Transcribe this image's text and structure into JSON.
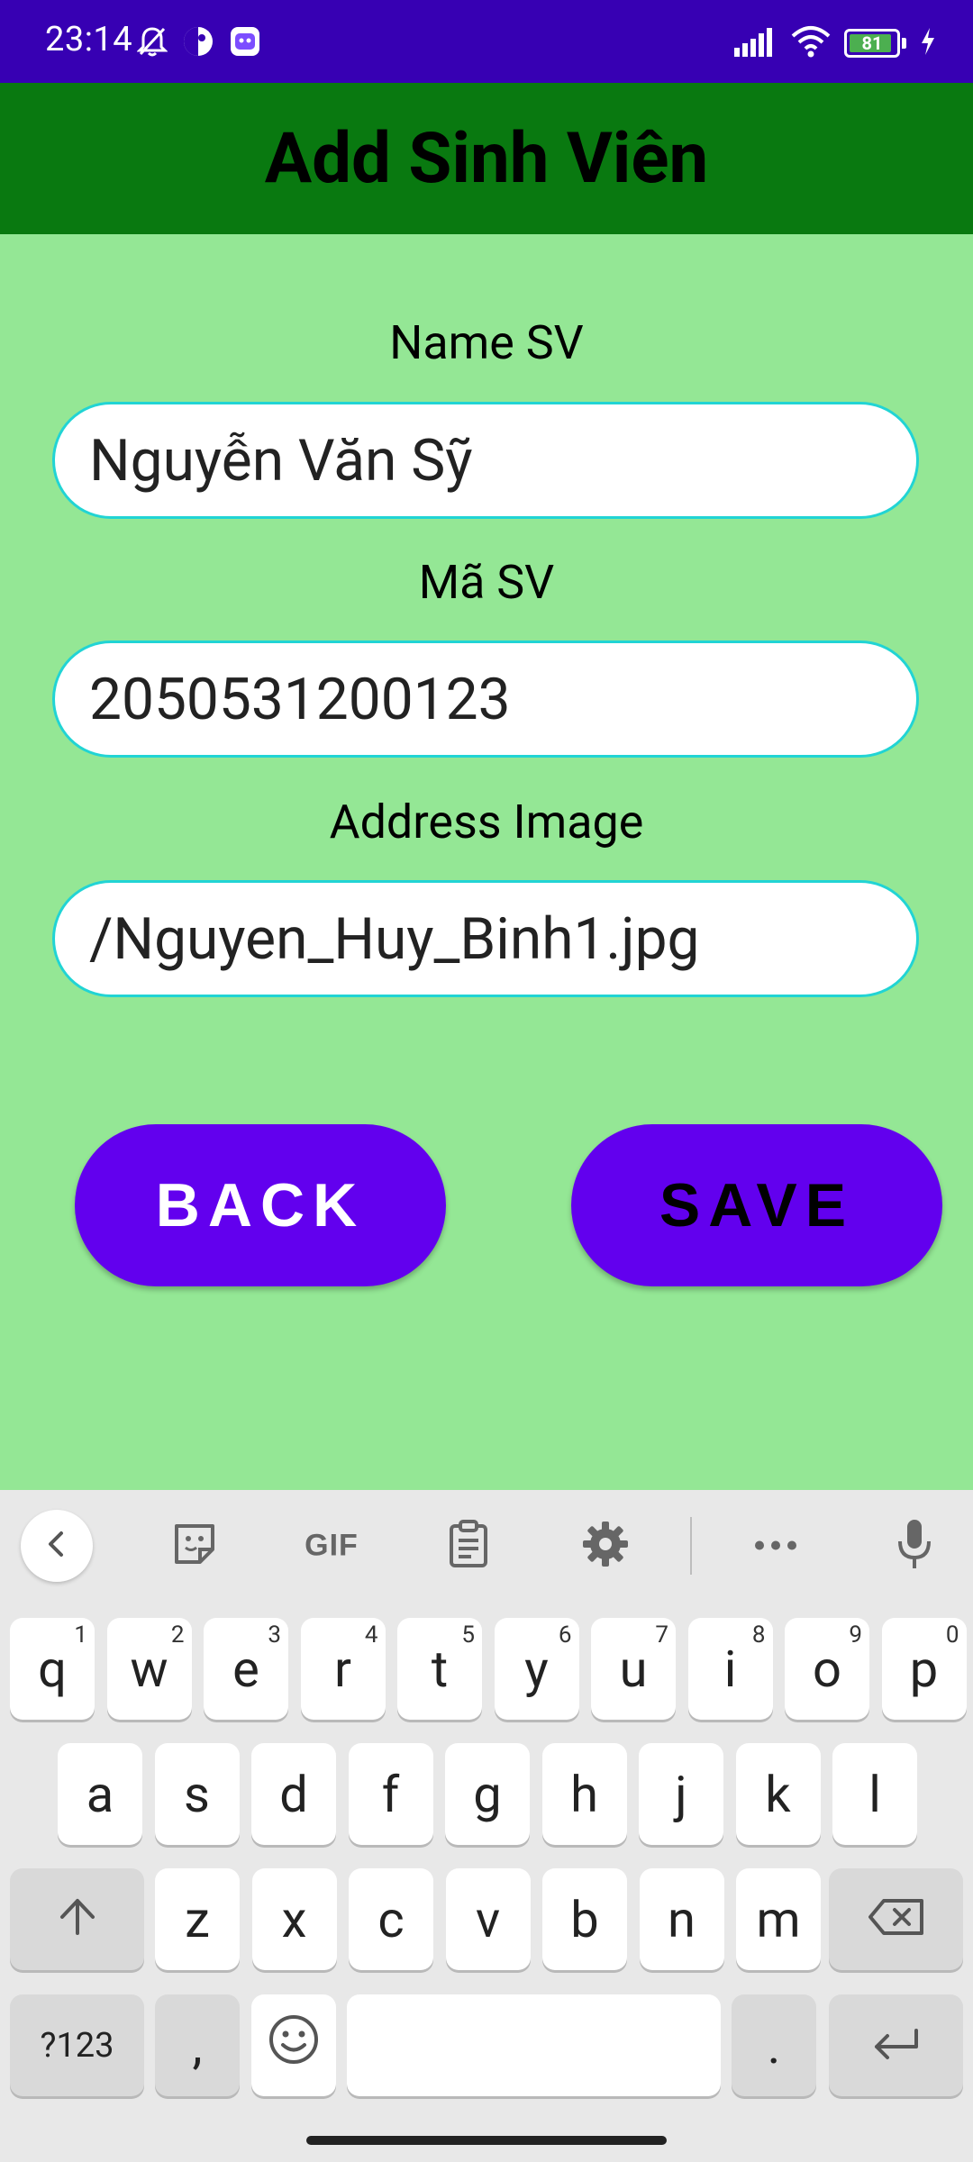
{
  "status_bar": {
    "time": "23:14",
    "battery_level": "81",
    "icons_left": [
      "bell-off-icon",
      "app-notif-icon",
      "app-notif2-icon"
    ],
    "icons_right": [
      "signal-icon",
      "wifi-icon",
      "battery-icon",
      "charging-icon"
    ]
  },
  "app_bar": {
    "title": "Add Sinh Viên"
  },
  "form": {
    "name_label": "Name SV",
    "name_value": "Nguyễn Văn Sỹ",
    "id_label": "Mã SV",
    "id_value": "2050531200123",
    "image_label": "Address Image",
    "image_value": "/Nguyen_Huy_Binh1.jpg"
  },
  "buttons": {
    "back": "BACK",
    "save": "SAVE"
  },
  "keyboard": {
    "toolbar": {
      "gif_label": "GIF"
    },
    "row1": [
      {
        "k": "q",
        "s": "1"
      },
      {
        "k": "w",
        "s": "2"
      },
      {
        "k": "e",
        "s": "3"
      },
      {
        "k": "r",
        "s": "4"
      },
      {
        "k": "t",
        "s": "5"
      },
      {
        "k": "y",
        "s": "6"
      },
      {
        "k": "u",
        "s": "7"
      },
      {
        "k": "i",
        "s": "8"
      },
      {
        "k": "o",
        "s": "9"
      },
      {
        "k": "p",
        "s": "0"
      }
    ],
    "row2": [
      "a",
      "s",
      "d",
      "f",
      "g",
      "h",
      "j",
      "k",
      "l"
    ],
    "row3": [
      "z",
      "x",
      "c",
      "v",
      "b",
      "n",
      "m"
    ],
    "symbols_label": "?123",
    "comma_label": ",",
    "period_label": "."
  },
  "colors": {
    "status_bar": "#3700b3",
    "app_bar": "#097910",
    "background": "#94e795",
    "button": "#6200ee",
    "input_border": "#21d4d4"
  }
}
